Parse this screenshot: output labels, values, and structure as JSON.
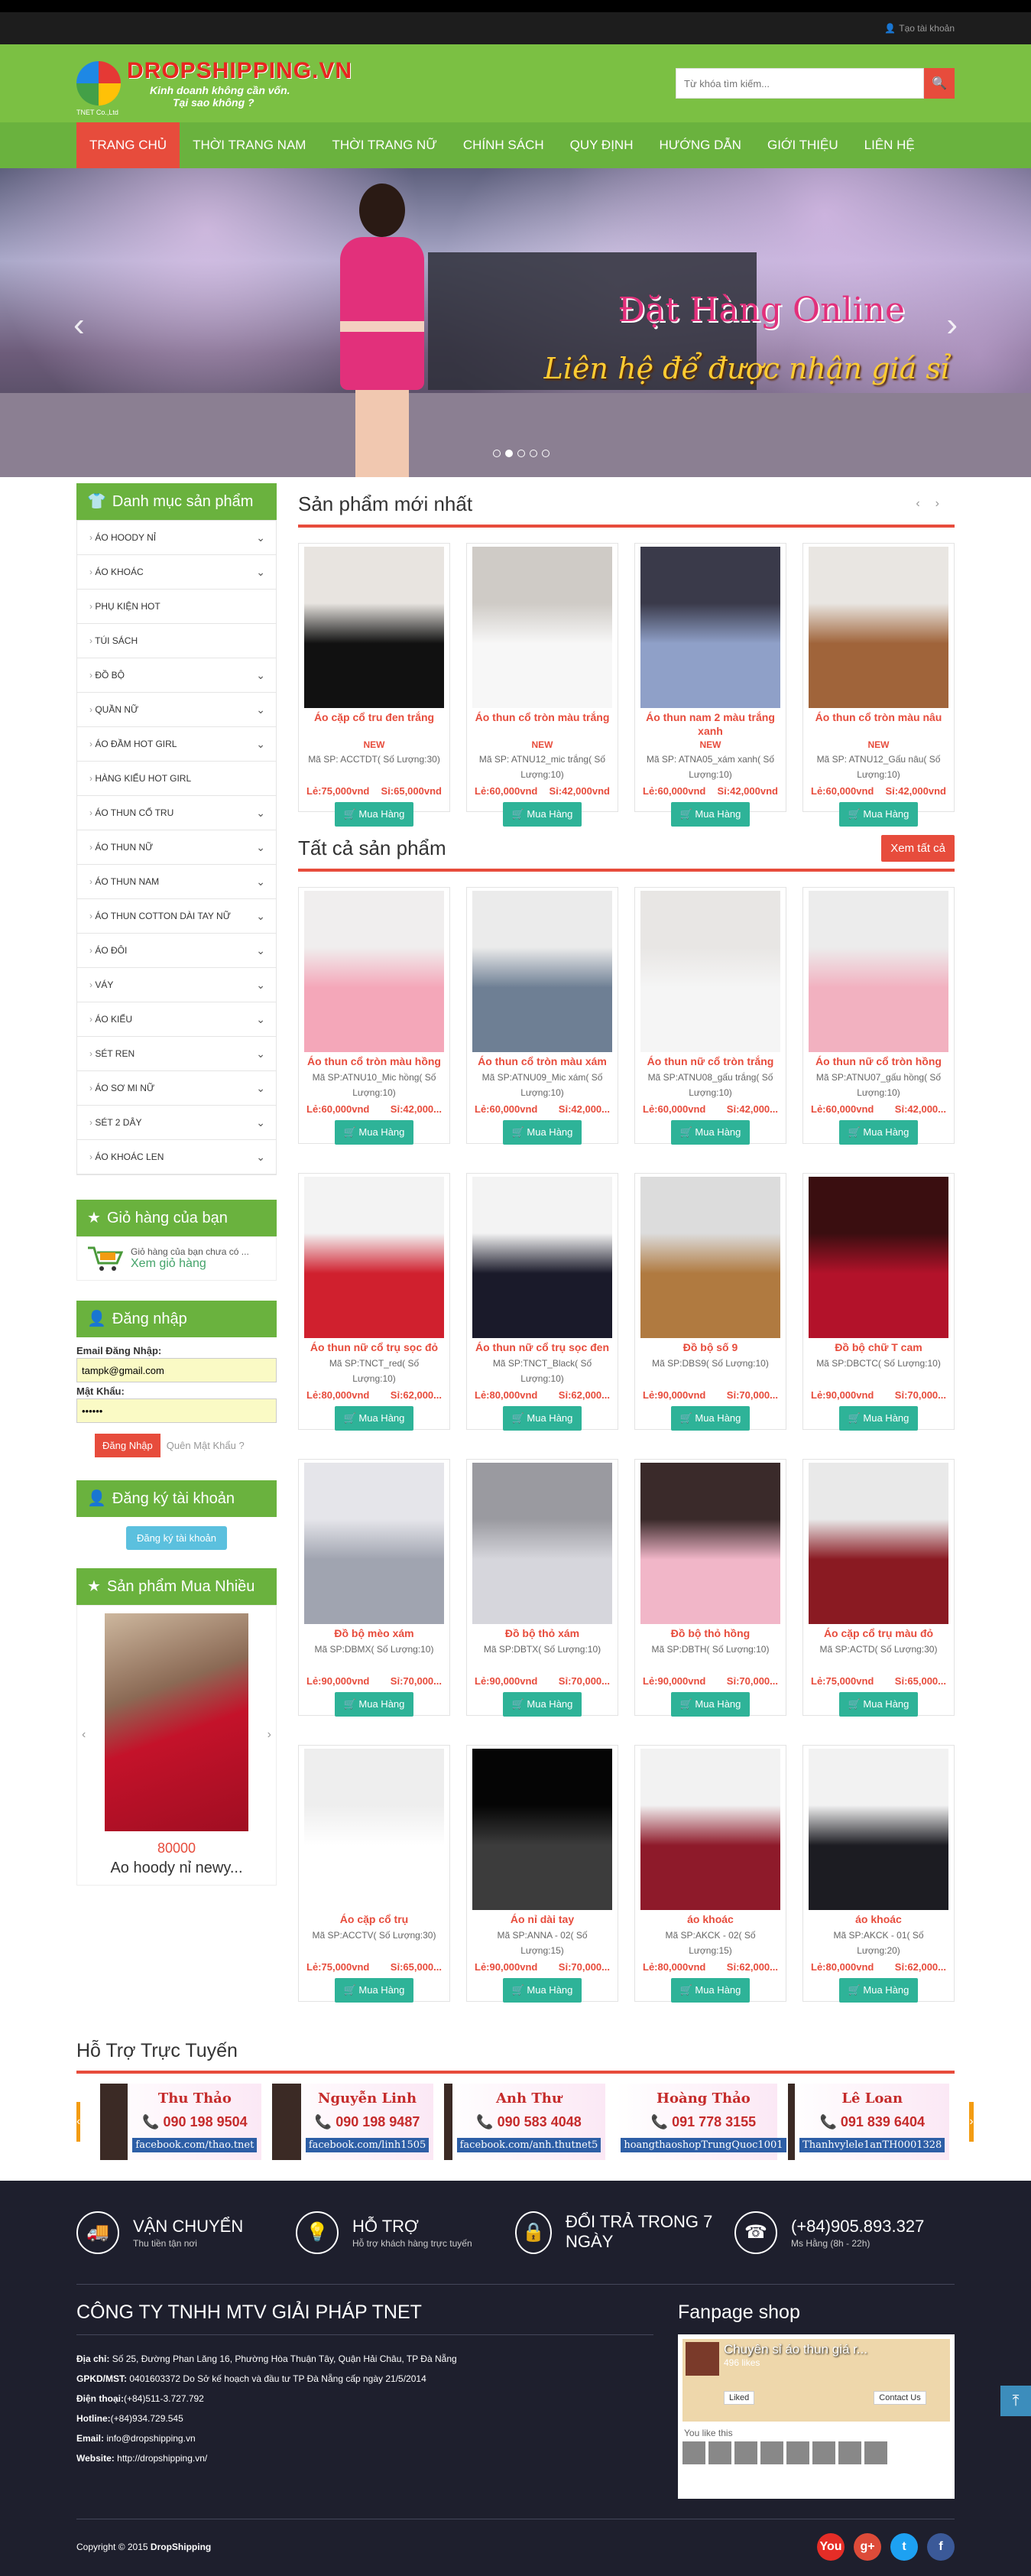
{
  "topbar": {
    "register": "Tạo tài khoản"
  },
  "header": {
    "logo_name": "DROPSHIPPING.VN",
    "logo_slogan1": "Kinh doanh không cần vốn.",
    "logo_slogan2": "Tại sao không ?",
    "logo_sub": "TNET Co.,Ltd",
    "search_placeholder": "Từ khóa tìm kiếm..."
  },
  "nav": [
    {
      "label": "TRANG CHỦ"
    },
    {
      "label": "THỜI TRANG NAM"
    },
    {
      "label": "THỜI TRANG NỮ"
    },
    {
      "label": "CHÍNH SÁCH"
    },
    {
      "label": "QUY ĐỊNH"
    },
    {
      "label": "HƯỚNG DẪN"
    },
    {
      "label": "GIỚI THIỆU"
    },
    {
      "label": "LIÊN HỆ"
    }
  ],
  "slider": {
    "caption1": "Đặt Hàng Online",
    "caption2": "Liên hệ để được nhận giá sỉ"
  },
  "sidebar": {
    "categories_title": "Danh mục sản phẩm",
    "categories": [
      {
        "label": "ÁO HOODY NỈ",
        "chev": "⌄"
      },
      {
        "label": "ÁO KHOÁC",
        "chev": "⌄"
      },
      {
        "label": "PHỤ KIỆN HOT",
        "chev": ""
      },
      {
        "label": "TÚI SÁCH",
        "chev": ""
      },
      {
        "label": "ĐỒ BỘ",
        "chev": "⌄"
      },
      {
        "label": "QUẦN NỮ",
        "chev": "⌄"
      },
      {
        "label": "ÁO ĐẦM HOT GIRL",
        "chev": "⌄"
      },
      {
        "label": "HÀNG KIỂU HOT GIRL",
        "chev": ""
      },
      {
        "label": "ÁO THUN CỔ TRU",
        "chev": "⌄"
      },
      {
        "label": "ÁO THUN NỮ",
        "chev": "⌄"
      },
      {
        "label": "ÁO THUN NAM",
        "chev": "⌄"
      },
      {
        "label": "ÁO THUN COTTON DÀI TAY NỮ",
        "chev": "⌄"
      },
      {
        "label": "ÁO ĐÔI",
        "chev": "⌄"
      },
      {
        "label": "VÁY",
        "chev": "⌄"
      },
      {
        "label": "ÁO KIỂU",
        "chev": "⌄"
      },
      {
        "label": "SÉT REN",
        "chev": "⌄"
      },
      {
        "label": "ÁO SƠ MI NỮ",
        "chev": "⌄"
      },
      {
        "label": "SÉT 2 DÂY",
        "chev": "⌄"
      },
      {
        "label": "ÁO KHOÁC LEN",
        "chev": "⌄"
      }
    ],
    "cart_title": "Giỏ hàng của bạn",
    "cart_text": "Giỏ hàng của bạn chưa có ...",
    "cart_link": "Xem giỏ hàng",
    "login_title": "Đăng nhập",
    "email_label": "Email Đăng Nhập:",
    "email_value": "tampk@gmail.com",
    "password_label": "Mật Khẩu:",
    "password_value": "••••••",
    "login_button": "Đăng Nhập",
    "forgot": "Quên Mật Khẩu ?",
    "register_title": "Đăng ký tài khoản",
    "register_button": "Đăng ký tài khoản",
    "best_title": "Sản phẩm Mua Nhiều",
    "best_price": "80000",
    "best_name": "Ao hoody nỉ newy..."
  },
  "new_products": {
    "title": "Sản phẩm mới nhất",
    "new_tag": "NEW",
    "items": [
      {
        "name": "Áo cặp cổ tru đen trắng",
        "code": "Mã SP: ACCTDT( Số Lượng:30)",
        "le": "Lẻ:75,000vnd",
        "si": "Sỉ:65,000vnd",
        "colors": [
          "#e8e4e0",
          "#111111"
        ]
      },
      {
        "name": "Áo thun cổ tròn màu trắng",
        "code": "Mã SP: ATNU12_mic trắng( Số Lượng:10)",
        "le": "Lẻ:60,000vnd",
        "si": "Sỉ:42,000vnd",
        "colors": [
          "#cfcbc6",
          "#f7f7f7"
        ]
      },
      {
        "name": "Áo thun nam 2 màu trắng xanh",
        "code": "Mã SP: ATNA05_xám xanh( Số Lượng:10)",
        "le": "Lẻ:60,000vnd",
        "si": "Sỉ:42,000vnd",
        "colors": [
          "#3a3a4a",
          "#8fa0c8"
        ]
      },
      {
        "name": "Áo thun cổ tròn màu nâu",
        "code": "Mã SP: ATNU12_Gấu nâu( Số Lượng:10)",
        "le": "Lẻ:60,000vnd",
        "si": "Sỉ:42,000vnd",
        "colors": [
          "#e9e6e2",
          "#a0643a"
        ]
      }
    ]
  },
  "all_products": {
    "title": "Tất cả sản phẩm",
    "see_all": "Xem tất cả",
    "buy_label": "Mua Hàng",
    "items": [
      {
        "name": "Áo thun cổ tròn màu hồng",
        "code": "Mã SP:ATNU10_Mic hồng( Số Lượng:10)",
        "le": "Lẻ:60,000vnd",
        "si": "Sỉ:42,000...",
        "colors": [
          "#f0eeee",
          "#f4a7b9"
        ]
      },
      {
        "name": "Áo thun cổ tròn màu xám",
        "code": "Mã SP:ATNU09_Mic xám( Số Lượng:10)",
        "le": "Lẻ:60,000vnd",
        "si": "Sỉ:42,000...",
        "colors": [
          "#ebebeb",
          "#6e7f94"
        ]
      },
      {
        "name": "Áo thun nữ cổ tròn trắng",
        "code": "Mã SP:ATNU08_gấu trắng( Số Lượng:10)",
        "le": "Lẻ:60,000vnd",
        "si": "Sỉ:42,000...",
        "colors": [
          "#e8e6e4",
          "#f5f5f5"
        ]
      },
      {
        "name": "Áo thun nữ cổ tròn hồng",
        "code": "Mã SP:ATNU07_gấu hồng( Số Lượng:10)",
        "le": "Lẻ:60,000vnd",
        "si": "Sỉ:42,000...",
        "colors": [
          "#ececec",
          "#f2b1c0"
        ]
      },
      {
        "name": "Áo thun nữ cổ trụ sọc đỏ",
        "code": "Mã SP:TNCT_red( Số Lượng:10)",
        "le": "Lẻ:80,000vnd",
        "si": "Sỉ:62,000...",
        "colors": [
          "#f3f3f3",
          "#d0202e"
        ]
      },
      {
        "name": "Áo thun nữ cổ trụ sọc đen",
        "code": "Mã SP:TNCT_Black( Số Lượng:10)",
        "le": "Lẻ:80,000vnd",
        "si": "Sỉ:62,000...",
        "colors": [
          "#f3f3f3",
          "#1a1a2a"
        ]
      },
      {
        "name": "Đồ bộ số 9",
        "code": "Mã SP:DBS9( Số Lượng:10)",
        "le": "Lẻ:90,000vnd",
        "si": "Sỉ:70,000...",
        "colors": [
          "#dcdcdc",
          "#b07a40"
        ]
      },
      {
        "name": "Đồ bộ chữ T cam",
        "code": "Mã SP:DBCTC( Số Lượng:10)",
        "le": "Lẻ:90,000vnd",
        "si": "Sỉ:70,000...",
        "colors": [
          "#3a0e10",
          "#b3122a"
        ]
      },
      {
        "name": "Đồ bộ mèo xám",
        "code": "Mã SP:DBMX( Số Lượng:10)",
        "le": "Lẻ:90,000vnd",
        "si": "Sỉ:70,000...",
        "colors": [
          "#e5e5ea",
          "#a0a4b0"
        ]
      },
      {
        "name": "Đồ bộ thỏ xám",
        "code": "Mã SP:DBTX( Số Lượng:10)",
        "le": "Lẻ:90,000vnd",
        "si": "Sỉ:70,000...",
        "colors": [
          "#9a9aa0",
          "#d6d6dc"
        ]
      },
      {
        "name": "Đồ bộ thỏ hồng",
        "code": "Mã SP:DBTH( Số Lượng:10)",
        "le": "Lẻ:90,000vnd",
        "si": "Sỉ:70,000...",
        "colors": [
          "#3a2a2a",
          "#f1b6c8"
        ]
      },
      {
        "name": "Áo cặp cổ trụ màu đỏ",
        "code": "Mã SP:ACTD( Số Lượng:30)",
        "le": "Lẻ:75,000vnd",
        "si": "Sỉ:65,000...",
        "colors": [
          "#e9e9e9",
          "#8a1a22"
        ]
      },
      {
        "name": "Áo cặp cổ trụ",
        "code": "Mã SP:ACCTV( Số Lượng:30)",
        "le": "Lẻ:75,000vnd",
        "si": "Sỉ:65,000...",
        "colors": [
          "#eeeeee",
          "#ffffff"
        ]
      },
      {
        "name": "Áo nỉ dài tay",
        "code": "Mã SP:ANNA - 02( Số Lượng:15)",
        "le": "Lẻ:90,000vnd",
        "si": "Sỉ:70,000...",
        "colors": [
          "#050505",
          "#3c3c3c"
        ]
      },
      {
        "name": "áo khoác",
        "code": "Mã SP:AKCK - 02( Số Lượng:15)",
        "le": "Lẻ:80,000vnd",
        "si": "Sỉ:62,000...",
        "colors": [
          "#f2f2f2",
          "#8e1a2a"
        ]
      },
      {
        "name": "áo khoác",
        "code": "Mã SP:AKCK - 01( Số Lượng:20)",
        "le": "Lẻ:80,000vnd",
        "si": "Sỉ:62,000...",
        "colors": [
          "#f2f2f2",
          "#1c1c22"
        ]
      }
    ]
  },
  "support": {
    "title": "Hỗ Trợ Trực Tuyến",
    "people": [
      {
        "name": "Thu Thảo",
        "phone": "090 198 9504",
        "fb": "facebook.com/thao.tnet"
      },
      {
        "name": "Nguyễn Linh",
        "phone": "090 198 9487",
        "fb": "facebook.com/linh1505"
      },
      {
        "name": "Anh Thư",
        "phone": "090 583 4048",
        "fb": "facebook.com/anh.thutnet5"
      },
      {
        "name": "Hoàng Thảo",
        "phone": "091 778 3155",
        "fb": "hoangthaoshopTrungQuoc1001"
      },
      {
        "name": "Lê Loan",
        "phone": "091 839 6404",
        "fb": "Thanhvylele1anTH0001328"
      }
    ]
  },
  "footer": {
    "services": [
      {
        "title": "VẬN CHUYỂN",
        "sub": "Thu tiền tận nơi",
        "icon": "🚚"
      },
      {
        "title": "HỖ TRỢ",
        "sub": "Hỗ trợ khách hàng trực tuyến",
        "icon": "💡"
      },
      {
        "title": "ĐỔI TRẢ TRONG 7 NGÀY",
        "sub": "",
        "icon": "🔒"
      },
      {
        "title": "(+84)905.893.327",
        "sub": "Ms Hằng (8h - 22h)",
        "icon": "☎"
      }
    ],
    "company_name": "CÔNG TY TNHH MTV GIẢI PHÁP TNET",
    "address_label": "Địa chỉ:",
    "address": "Số 25, Đường Phan Lăng 16, Phường Hòa Thuận Tây, Quận Hải Châu, TP Đà Nẵng",
    "license_label": "GPKD/MST:",
    "license": "0401603372 Do Sở kế hoạch và đầu tư TP Đà Nẵng cấp ngày 21/5/2014",
    "phone_label": "Điện thoại:",
    "phone": "(+84)511-3.727.792",
    "hotline_label": "Hotline:",
    "hotline": "(+84)934.729.545",
    "email_label": "Email:",
    "email": "info@dropshipping.vn",
    "website_label": "Website:",
    "website": "http://dropshipping.vn/",
    "fanpage_title": "Fanpage shop",
    "fb_page_name": "Chuyên sỉ áo thun giá r...",
    "fb_page_likes": "496 likes",
    "fb_liked": "Liked",
    "fb_contact": "Contact Us",
    "fb_friends": "You like this",
    "copyright_prefix": "Copyright © 2015",
    "copyright_brand": "DropShipping",
    "social": [
      {
        "label": "You",
        "color": "#e52d27"
      },
      {
        "label": "g+",
        "color": "#dd4b39"
      },
      {
        "label": "t",
        "color": "#1da1f2"
      },
      {
        "label": "f",
        "color": "#3b5998"
      }
    ]
  },
  "colors": {
    "accent": "#e74c3c",
    "green": "#6ab23e",
    "buy": "#2eb398",
    "footer": "#1e1f2d"
  }
}
